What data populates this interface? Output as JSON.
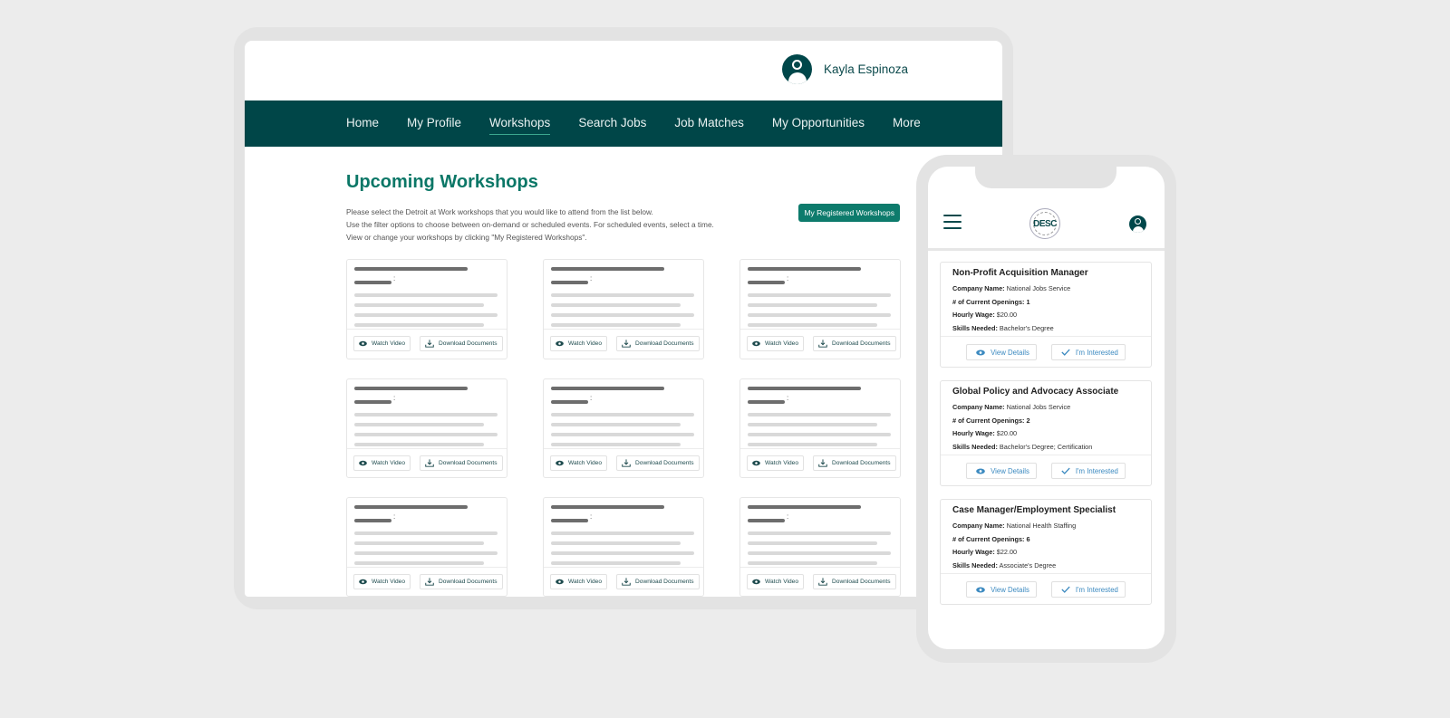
{
  "desktop": {
    "user": {
      "name": "Kayla Espinoza",
      "avatar_icon": "user-avatar-icon"
    },
    "nav": {
      "items": [
        {
          "label": "Home",
          "active": false
        },
        {
          "label": "My Profile",
          "active": false
        },
        {
          "label": "Workshops",
          "active": true
        },
        {
          "label": "Search Jobs",
          "active": false
        },
        {
          "label": "Job Matches",
          "active": false
        },
        {
          "label": "My Opportunities",
          "active": false
        },
        {
          "label": "More",
          "active": false
        }
      ]
    },
    "page": {
      "title": "Upcoming Workshops",
      "intro_lines": [
        "Please select the Detroit at Work workshops that you would like to attend from the list below.",
        "Use the filter options to choose between on-demand or scheduled events. For scheduled events, select a time.",
        "View or change your workshops by clicking \"My Registered Workshops\"."
      ],
      "registered_button": "My Registered Workshops"
    },
    "workshop_card": {
      "watch_label": "Watch Video",
      "download_label": "Download Documents",
      "watch_icon": "eye-icon",
      "download_icon": "download-icon",
      "colon": ":",
      "count": 9
    }
  },
  "mobile": {
    "logo_text": "DESC",
    "menu_icon": "hamburger-menu-icon",
    "jobs": [
      {
        "title": "Non-Profit Acquisition Manager",
        "company_label": "Company Name:",
        "company": "National Jobs Service",
        "openings_label": "# of Current Openings:",
        "openings": "1",
        "wage_label": "Hourly Wage:",
        "wage": "$20.00",
        "skills_label": "Skills Needed:",
        "skills": "Bachelor's Degree"
      },
      {
        "title": "Global Policy and Advocacy Associate",
        "company_label": "Company Name:",
        "company": "National Jobs Service",
        "openings_label": "# of Current Openings:",
        "openings": "2",
        "wage_label": "Hourly Wage:",
        "wage": "$20.00",
        "skills_label": "Skills Needed:",
        "skills": "Bachelor's Degree; Certification"
      },
      {
        "title": "Case Manager/Employment Specialist",
        "company_label": "Company Name:",
        "company": "National Health Staffing",
        "openings_label": "# of Current Openings:",
        "openings": "6",
        "wage_label": "Hourly Wage:",
        "wage": "$22.00",
        "skills_label": "Skills Needed:",
        "skills": "Associate's Degree"
      }
    ],
    "view_details_label": "View Details",
    "interested_label": "I'm Interested"
  },
  "colors": {
    "nav_bg": "#004648",
    "accent": "#0d7b6c",
    "title": "#0b7767",
    "link_blue": "#3c8ac0"
  }
}
